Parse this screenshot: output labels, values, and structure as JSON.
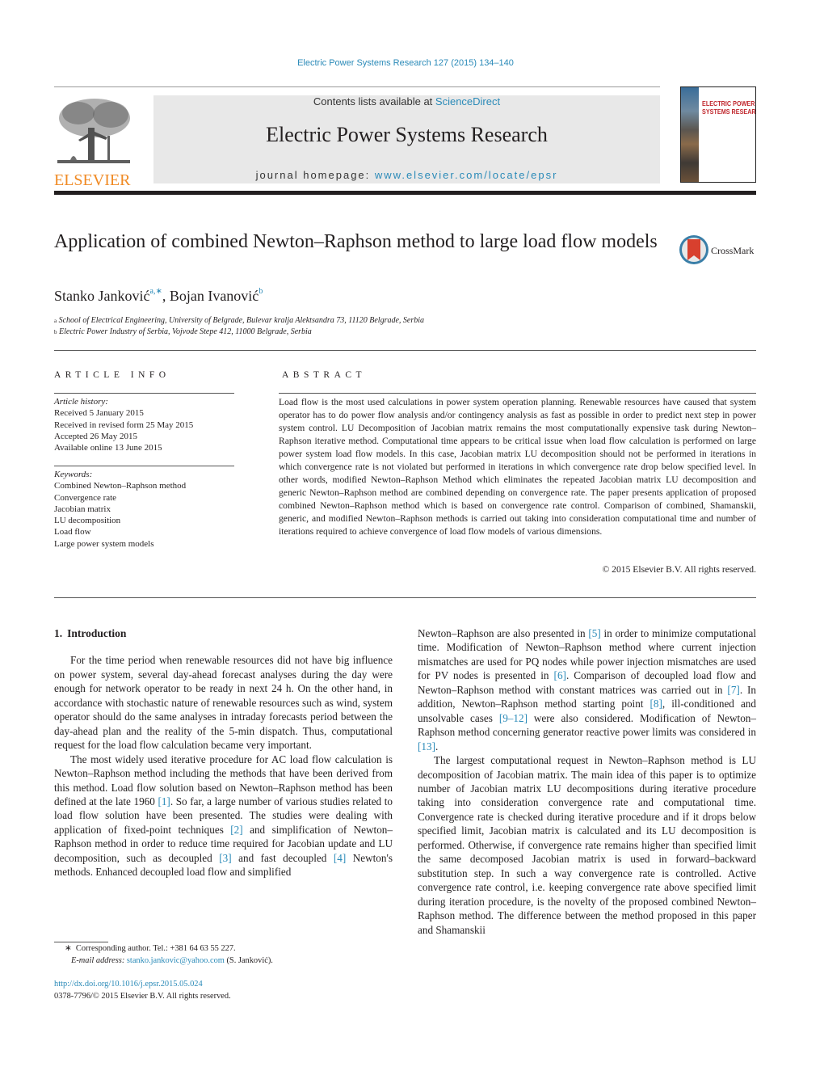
{
  "journal_ref": "Electric Power Systems Research 127 (2015) 134–140",
  "masthead": {
    "contents_prefix": "Contents lists available at ",
    "contents_link": "ScienceDirect",
    "journal_title": "Electric Power Systems Research",
    "homepage_prefix": "journal homepage: ",
    "homepage_link": "www.elsevier.com/locate/epsr"
  },
  "publisher_logo": {
    "wordmark": "ELSEVIER",
    "color": "#f08a24"
  },
  "cover": {
    "title_line1": "ELECTRIC POWER",
    "title_line2": "SYSTEMS RESEARCH",
    "title_color": "#c0272d"
  },
  "crossmark": {
    "label": "CrossMark"
  },
  "article": {
    "title": "Application of combined Newton–Raphson method to large load flow models",
    "authors": [
      {
        "name": "Stanko Janković",
        "sup": "a,∗"
      },
      {
        "name": "Bojan Ivanović",
        "sup": "b"
      }
    ],
    "affiliations": [
      {
        "sup": "a",
        "text": "School of Electrical Engineering, University of Belgrade, Bulevar kralja Alektsandra 73, 11120 Belgrade, Serbia"
      },
      {
        "sup": "b",
        "text": "Electric Power Industry of Serbia, Vojvode Stepe 412, 11000 Belgrade, Serbia"
      }
    ]
  },
  "article_info": {
    "heading": "ARTICLE INFO",
    "history_label": "Article history:",
    "history": [
      "Received 5 January 2015",
      "Received in revised form 25 May 2015",
      "Accepted 26 May 2015",
      "Available online 13 June 2015"
    ],
    "keywords_label": "Keywords:",
    "keywords": [
      "Combined Newton–Raphson method",
      "Convergence rate",
      "Jacobian matrix",
      "LU decomposition",
      "Load flow",
      "Large power system models"
    ]
  },
  "abstract": {
    "heading": "ABSTRACT",
    "text": "Load flow is the most used calculations in power system operation planning. Renewable resources have caused that system operator has to do power flow analysis and/or contingency analysis as fast as possible in order to predict next step in power system control. LU Decomposition of Jacobian matrix remains the most computationally expensive task during Newton–Raphson iterative method. Computational time appears to be critical issue when load flow calculation is performed on large power system load flow models. In this case, Jacobian matrix LU decomposition should not be performed in iterations in which convergence rate is not violated but performed in iterations in which convergence rate drop below specified level. In other words, modified Newton–Raphson Method which eliminates the repeated Jacobian matrix LU decomposition and generic Newton–Raphson method are combined depending on convergence rate. The paper presents application of proposed combined Newton–Raphson method which is based on convergence rate control. Comparison of combined, Shamanskii, generic, and modified Newton–Raphson methods is carried out taking into consideration computational time and number of iterations required to achieve convergence of load flow models of various dimensions.",
    "copyright": "© 2015 Elsevier B.V. All rights reserved."
  },
  "section1": {
    "number": "1.",
    "title": "Introduction",
    "p1": "For the time period when renewable resources did not have big influence on power system, several day-ahead forecast analyses during the day were enough for network operator to be ready in next 24 h. On the other hand, in accordance with stochastic nature of renewable resources such as wind, system operator should do the same analyses in intraday forecasts period between the day-ahead plan and the reality of the 5-min dispatch. Thus, computational request for the load flow calculation became very important.",
    "p2": [
      "The most widely used iterative procedure for AC load flow calculation is Newton–Raphson method including the methods that have been derived from this method. Load flow solution based on Newton–Raphson method has been defined at the late 1960 ",
      "[1]",
      ". So far, a large number of various studies related to load flow solution have been presented. The studies were dealing with application of fixed-point techniques ",
      "[2]",
      " and simplification of Newton–Raphson method in order to reduce time required for Jacobian update and LU decomposition, such as decoupled ",
      "[3]",
      " and fast decoupled ",
      "[4]",
      " Newton's methods. Enhanced decoupled load flow and simplified "
    ],
    "p2_cont": [
      "Newton–Raphson are also presented in ",
      "[5]",
      " in order to minimize computational time. Modification of Newton–Raphson method where current injection mismatches are used for PQ nodes while power injection mismatches are used for PV nodes is presented in ",
      "[6]",
      ". Comparison of decoupled load flow and Newton–Raphson method with constant matrices was carried out in ",
      "[7]",
      ". In addition, Newton–Raphson method starting point ",
      "[8]",
      ", ill-conditioned and unsolvable cases ",
      "[9–12]",
      " were also considered. Modification of Newton–Raphson method concerning generator reactive power limits was considered in ",
      "[13]",
      "."
    ],
    "p3": "The largest computational request in Newton–Raphson method is LU decomposition of Jacobian matrix. The main idea of this paper is to optimize number of Jacobian matrix LU decompositions during iterative procedure taking into consideration convergence rate and computational time. Convergence rate is checked during iterative procedure and if it drops below specified limit, Jacobian matrix is calculated and its LU decomposition is performed. Otherwise, if convergence rate remains higher than specified limit the same decomposed Jacobian matrix is used in forward–backward substitution step. In such a way convergence rate is controlled. Active convergence rate control, i.e. keeping convergence rate above specified limit during iteration procedure, is the novelty of the proposed combined Newton–Raphson method. The difference between the method proposed in this paper and Shamanskii"
  },
  "footnote": {
    "marker": "∗",
    "corresponding": "Corresponding author. Tel.: +381 64 63 55 227.",
    "email_label": "E-mail address:",
    "email": "stanko.jankovic@yahoo.com",
    "email_suffix": " (S. Janković)."
  },
  "doi": "http://dx.doi.org/10.1016/j.epsr.2015.05.024",
  "issn_line": "0378-7796/© 2015 Elsevier B.V. All rights reserved.",
  "colors": {
    "link": "#2a8ab8",
    "elsevier_orange": "#f08a24",
    "masthead_bg": "#e8e8e8"
  }
}
